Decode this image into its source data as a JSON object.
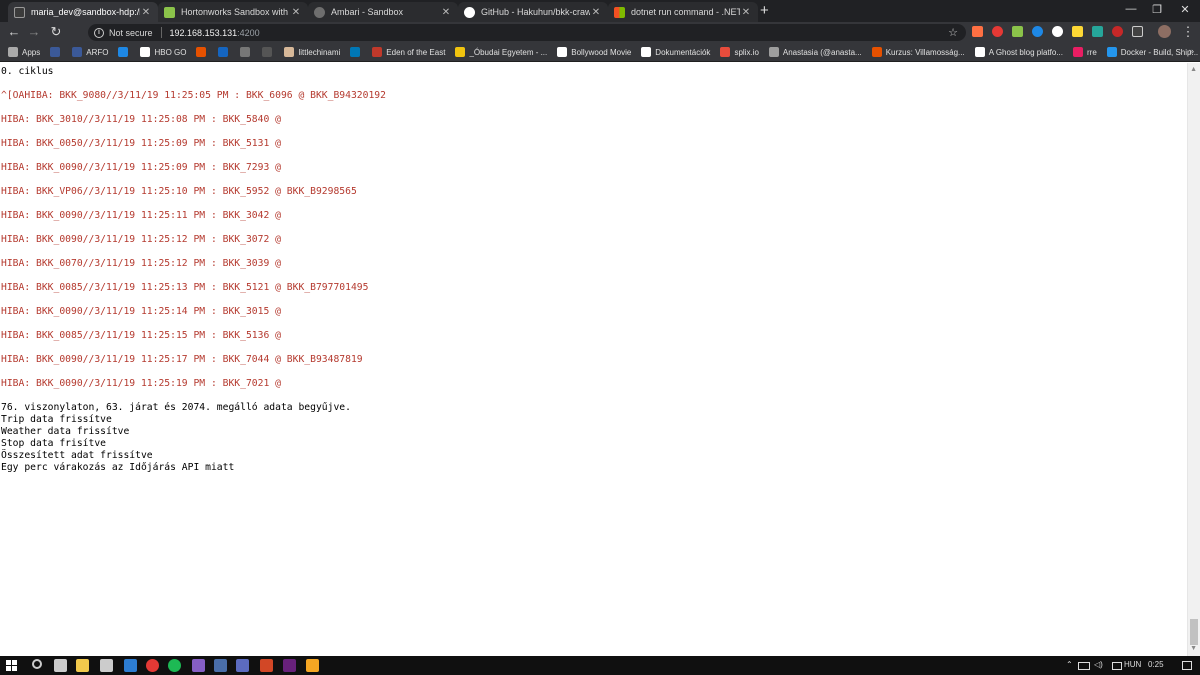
{
  "tabs": [
    {
      "title": "maria_dev@sandbox-hdp:/bkk-c",
      "color": "#3b3b3b",
      "active": true
    },
    {
      "title": "Hortonworks Sandbox with HDP",
      "color": "#8bc34a",
      "active": false
    },
    {
      "title": "Ambari - Sandbox",
      "color": "#6e6e6e",
      "active": false
    },
    {
      "title": "GitHub - Hakuhun/bkk-crawler-l",
      "color": "#ffffff",
      "active": false
    },
    {
      "title": "dotnet run command - .NET Cor",
      "color": "#f25022",
      "active": false
    }
  ],
  "tab_close": "✕",
  "new_tab": "+",
  "window_controls": {
    "minimize": "—",
    "restore": "❐",
    "close": "✕"
  },
  "toolbar": {
    "back": "←",
    "forward": "→",
    "reload": "↻",
    "not_secure": "Not secure",
    "url_host": "192.168.153.131",
    "url_port": ":4200",
    "star": "☆",
    "menu": "⋮"
  },
  "bookmarks": [
    {
      "label": "Apps",
      "color": "#aaaaaa"
    },
    {
      "label": "",
      "color": "#3b5998"
    },
    {
      "label": "ARFO",
      "color": "#3b5998"
    },
    {
      "label": "",
      "color": "#1e88e5"
    },
    {
      "label": "HBO GO",
      "color": "#ffffff"
    },
    {
      "label": "",
      "color": "#e65100"
    },
    {
      "label": "",
      "color": "#1565c0"
    },
    {
      "label": "",
      "color": "#777777"
    },
    {
      "label": "",
      "color": "#555555"
    },
    {
      "label": "littlechinami",
      "color": "#d7b899"
    },
    {
      "label": "",
      "color": "#0077b5"
    },
    {
      "label": "Eden of the East",
      "color": "#c0392b"
    },
    {
      "label": "_Óbudai Egyetem - ...",
      "color": "#f1c40f"
    },
    {
      "label": "Bollywood Movie",
      "color": "#ffffff"
    },
    {
      "label": "Dokumentációk",
      "color": "#ffffff"
    },
    {
      "label": "splix.io",
      "color": "#e74c3c"
    },
    {
      "label": "Anastasia (@anasta...",
      "color": "#9e9e9e"
    },
    {
      "label": "Kurzus: Villamosság...",
      "color": "#e65100"
    },
    {
      "label": "A Ghost blog platfo...",
      "color": "#ffffff"
    },
    {
      "label": "rre",
      "color": "#e91e63"
    },
    {
      "label": "Docker - Build, Ship...",
      "color": "#2496ed"
    }
  ],
  "bookmarks_more": "»",
  "console": {
    "header": "0. ciklus",
    "errors": [
      "^[OAHIBA: BKK_9080//3/11/19 11:25:05 PM : BKK_6096 @ BKK_B94320192",
      "HIBA: BKK_3010//3/11/19 11:25:08 PM : BKK_5840 @",
      "HIBA: BKK_0050//3/11/19 11:25:09 PM : BKK_5131 @",
      "HIBA: BKK_0090//3/11/19 11:25:09 PM : BKK_7293 @",
      "HIBA: BKK_VP06//3/11/19 11:25:10 PM : BKK_5952 @ BKK_B9298565",
      "HIBA: BKK_0090//3/11/19 11:25:11 PM : BKK_3042 @",
      "HIBA: BKK_0090//3/11/19 11:25:12 PM : BKK_3072 @",
      "HIBA: BKK_0070//3/11/19 11:25:12 PM : BKK_3039 @",
      "HIBA: BKK_0085//3/11/19 11:25:13 PM : BKK_5121 @ BKK_B797701495",
      "HIBA: BKK_0090//3/11/19 11:25:14 PM : BKK_3015 @",
      "HIBA: BKK_0085//3/11/19 11:25:15 PM : BKK_5136 @",
      "HIBA: BKK_0090//3/11/19 11:25:17 PM : BKK_7044 @ BKK_B93487819",
      "HIBA: BKK_0090//3/11/19 11:25:19 PM : BKK_7021 @"
    ],
    "summary": [
      "76. viszonylaton, 63. járat és 2074. megálló adata begyűjve.",
      "Trip data frissítve",
      "Weather data frissítve",
      "Stop data frisítve",
      "Összesített adat frissítve",
      "Egy perc várakozás az Időjárás API miatt"
    ]
  },
  "taskbar": {
    "apps": [
      {
        "name": "search",
        "color": "#cccccc"
      },
      {
        "name": "task-view",
        "color": "#cccccc"
      },
      {
        "name": "file-explorer",
        "color": "#f2c94c"
      },
      {
        "name": "store",
        "color": "#cccccc"
      },
      {
        "name": "store-2",
        "color": "#2d7dd2"
      },
      {
        "name": "chrome",
        "color": "#e53935"
      },
      {
        "name": "spotify",
        "color": "#1db954"
      },
      {
        "name": "visual-studio",
        "color": "#865fc5"
      },
      {
        "name": "terminal",
        "color": "#4a6ea9"
      },
      {
        "name": "vs-code",
        "color": "#5c6bc0"
      },
      {
        "name": "powerpoint",
        "color": "#d24726"
      },
      {
        "name": "visual-studio-2",
        "color": "#68217a"
      },
      {
        "name": "app",
        "color": "#f5a623"
      }
    ],
    "language": "HUN",
    "time": "0:25",
    "tray_up": "⌃"
  },
  "colors": {
    "error_text": "#b53a2f",
    "chrome_dark": "#35363a",
    "taskbar": "#101010"
  }
}
